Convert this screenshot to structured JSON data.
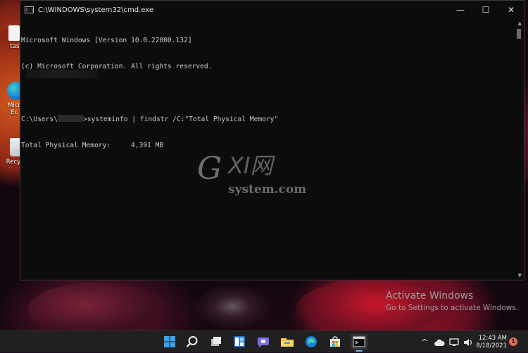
{
  "window": {
    "title": "C:\\WINDOWS\\system32\\cmd.exe",
    "app_icon_text": "C:\\",
    "minimize_glyph": "—",
    "maximize_glyph": "☐",
    "close_glyph": "✕"
  },
  "terminal": {
    "line1": "Microsoft Windows [Version 10.0.22000.132]",
    "line2": "(c) Microsoft Corporation. All rights reserved.",
    "prompt_prefix": "C:\\Users\\",
    "prompt_suffix": ">systeminfo | findstr /C:\"Total Physical Memory\"",
    "output_line": "Total Physical Memory:     4,391 MB"
  },
  "desktop": {
    "icons": [
      {
        "label": "tas",
        "icon": "file-icon"
      },
      {
        "label": "Micr\nEc",
        "icon": "edge-icon"
      },
      {
        "label": "Recy",
        "icon": "recycle-bin-icon"
      }
    ]
  },
  "watermark": {
    "top": "GXI网",
    "bottom": "system.com"
  },
  "activation": {
    "title": "Activate Windows",
    "subtitle": "Go to Settings to activate Windows."
  },
  "taskbar": {
    "apps": [
      "windows-start-icon",
      "search-icon",
      "task-view-icon",
      "widgets-icon",
      "teams-chat-icon",
      "file-explorer-icon",
      "edge-icon",
      "microsoft-store-icon",
      "terminal-icon"
    ],
    "tray": {
      "chevron": "^",
      "time": "12:43 AM",
      "date": "8/18/2021",
      "notifications": "1"
    }
  },
  "colors": {
    "terminal_bg": "#0c0c0c",
    "terminal_text": "#cccccc",
    "taskbar_bg": "#202020"
  }
}
